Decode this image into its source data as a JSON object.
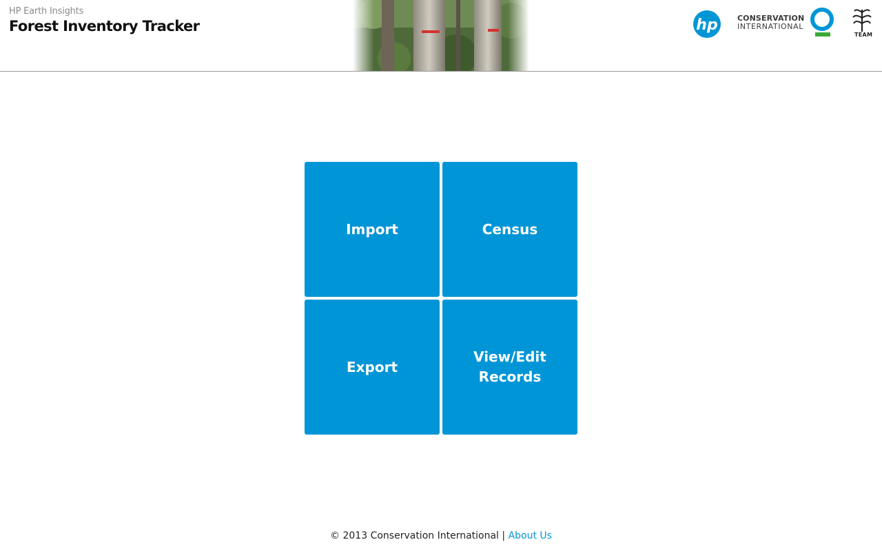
{
  "header": {
    "subtitle": "HP Earth Insights",
    "title": "Forest Inventory Tracker",
    "logos": {
      "hp": "hp",
      "ci_line1": "CONSERVATION",
      "ci_line2": "INTERNATIONAL",
      "team": "TEAM"
    }
  },
  "tiles": [
    {
      "label": "Import"
    },
    {
      "label": "Census"
    },
    {
      "label": "Export"
    },
    {
      "label": "View/Edit\nRecords"
    }
  ],
  "footer": {
    "copyright": "© 2013 Conservation International |",
    "about_link": "About Us"
  },
  "colors": {
    "accent": "#0095d6",
    "ci_green": "#3aaa35"
  }
}
